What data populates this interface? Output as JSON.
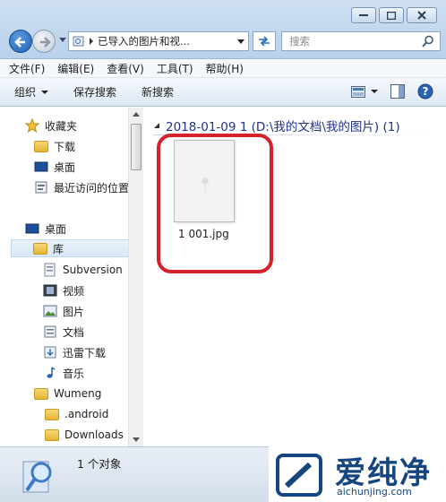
{
  "window": {
    "address": "已导入的图片和视...",
    "search_placeholder": "搜索"
  },
  "menu": [
    "文件(F)",
    "编辑(E)",
    "查看(V)",
    "工具(T)",
    "帮助(H)"
  ],
  "toolbar": {
    "organize": "组织",
    "save_search": "保存搜索",
    "new_search": "新搜索"
  },
  "sidebar": {
    "favorites": "收藏夹",
    "downloads": "下载",
    "desktop_fav": "桌面",
    "recent": "最近访问的位置",
    "desktop": "桌面",
    "library": "库",
    "subversion": "Subversion",
    "videos": "视频",
    "pictures": "图片",
    "documents": "文档",
    "xunlei": "迅雷下载",
    "music": "音乐",
    "user": "Wumeng",
    "android": ".android",
    "downloads_folder": "Downloads"
  },
  "content": {
    "group_header": "2018-01-09 1 (D:\\我的文档\\我的图片) (1)",
    "file_name": "1 001.jpg"
  },
  "status": {
    "count": "1 个对象"
  },
  "watermark": {
    "title": "爱纯净",
    "url": "aichunjing.com"
  }
}
